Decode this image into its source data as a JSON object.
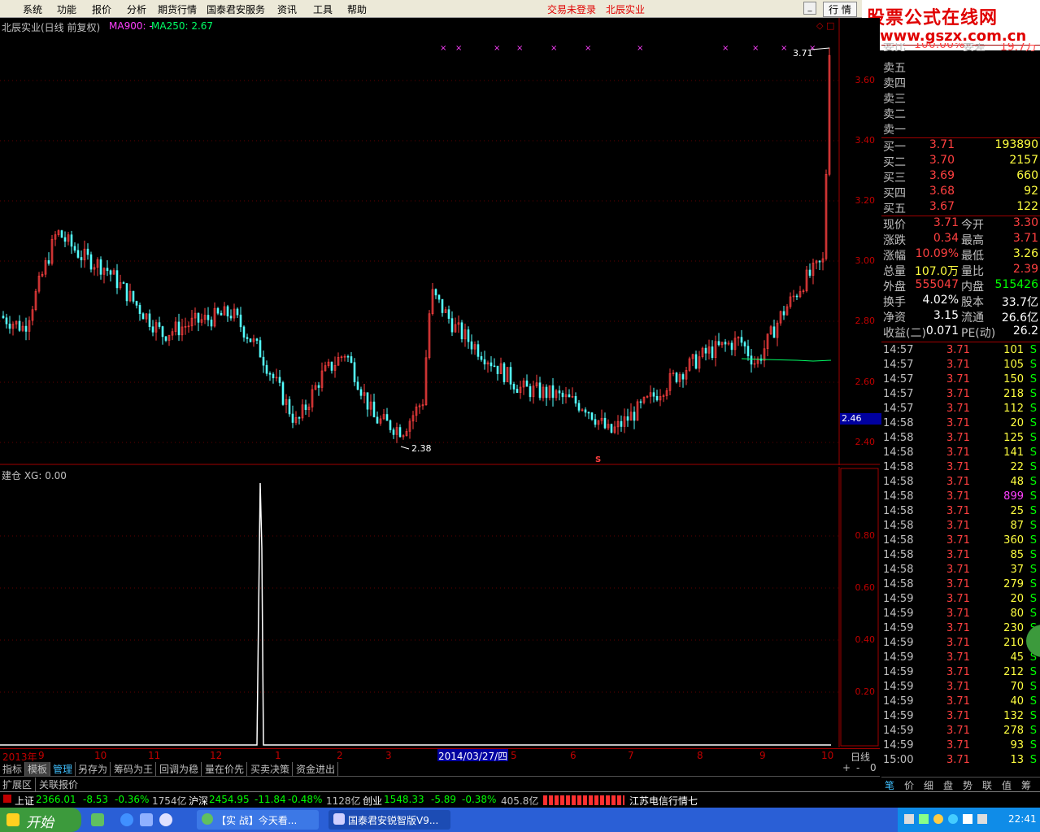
{
  "menu": {
    "items": [
      "系统",
      "功能",
      "报价",
      "分析",
      "期货行情",
      "国泰君安服务",
      "资讯",
      "工具",
      "帮助"
    ],
    "status_login": "交易未登录",
    "stock_name": "北辰实业",
    "quote_btn": "行 情"
  },
  "watermark": {
    "line1": "股票公式在线网",
    "line2": "www.gszx.com.cn"
  },
  "main_chart": {
    "title": "北辰实业(日线 前复权)",
    "ma900": "MA900: -",
    "ma250": "MA250: 2.67",
    "price_axis": [
      "3.60",
      "3.40",
      "3.20",
      "3.00",
      "2.80",
      "2.60",
      "2.40"
    ],
    "current_price_tag": "2.46",
    "high_label": "3.71",
    "low_label": "2.38",
    "s_marker": "S"
  },
  "sub_chart": {
    "title": "建仓 XG: 0.00",
    "axis": [
      "0.80",
      "0.60",
      "0.40",
      "0.20"
    ]
  },
  "time_axis": {
    "labels": [
      "2013年",
      "9",
      "10",
      "11",
      "12",
      "1",
      "2",
      "3",
      "2014/03/27/四",
      "5",
      "6",
      "7",
      "8",
      "9",
      "10"
    ],
    "period": "日线",
    "controls": [
      "+",
      "-",
      "0"
    ]
  },
  "tabs1": [
    "指标",
    "模板",
    "管理",
    "另存为",
    "筹码为王",
    "回调为稳",
    "量在价先",
    "买卖决策",
    "资金进出"
  ],
  "tabs2": [
    "扩展区",
    "关联报价"
  ],
  "order_book": {
    "top_row": {
      "label": "委比",
      "value": "100.00%",
      "label2": "委差",
      "value2": "19.7万"
    },
    "sells": [
      {
        "label": "卖五"
      },
      {
        "label": "卖四"
      },
      {
        "label": "卖三"
      },
      {
        "label": "卖二"
      },
      {
        "label": "卖一"
      }
    ],
    "buys": [
      {
        "label": "买一",
        "price": "3.71",
        "vol": "193890"
      },
      {
        "label": "买二",
        "price": "3.70",
        "vol": "2157"
      },
      {
        "label": "买三",
        "price": "3.69",
        "vol": "660"
      },
      {
        "label": "买四",
        "price": "3.68",
        "vol": "92"
      },
      {
        "label": "买五",
        "price": "3.67",
        "vol": "122"
      }
    ]
  },
  "quote_stats": [
    {
      "l1": "现价",
      "v1": "3.71",
      "c1": "red",
      "l2": "今开",
      "v2": "3.30",
      "c2": "red"
    },
    {
      "l1": "涨跌",
      "v1": "0.34",
      "c1": "red",
      "l2": "最高",
      "v2": "3.71",
      "c2": "red"
    },
    {
      "l1": "涨幅",
      "v1": "10.09%",
      "c1": "red",
      "l2": "最低",
      "v2": "3.26",
      "c2": "yellow"
    },
    {
      "l1": "总量",
      "v1": "107.0万",
      "c1": "yellow",
      "l2": "量比",
      "v2": "2.39",
      "c2": "red"
    },
    {
      "l1": "外盘",
      "v1": "555047",
      "c1": "red",
      "l2": "内盘",
      "v2": "515426",
      "c2": "green"
    },
    {
      "l1": "换手",
      "v1": "4.02%",
      "c1": "white",
      "l2": "股本",
      "v2": "33.7亿",
      "c2": "white"
    },
    {
      "l1": "净资",
      "v1": "3.15",
      "c1": "white",
      "l2": "流通",
      "v2": "26.6亿",
      "c2": "white"
    },
    {
      "l1": "收益(二)",
      "v1": "0.071",
      "c1": "white",
      "l2": "PE(动)",
      "v2": "26.2",
      "c2": "white"
    }
  ],
  "ticks": [
    {
      "t": "14:57",
      "p": "3.71",
      "v": "101",
      "s": "S"
    },
    {
      "t": "14:57",
      "p": "3.71",
      "v": "105",
      "s": "S"
    },
    {
      "t": "14:57",
      "p": "3.71",
      "v": "150",
      "s": "S"
    },
    {
      "t": "14:57",
      "p": "3.71",
      "v": "218",
      "s": "S"
    },
    {
      "t": "14:57",
      "p": "3.71",
      "v": "112",
      "s": "S"
    },
    {
      "t": "14:58",
      "p": "3.71",
      "v": "20",
      "s": "S"
    },
    {
      "t": "14:58",
      "p": "3.71",
      "v": "125",
      "s": "S"
    },
    {
      "t": "14:58",
      "p": "3.71",
      "v": "141",
      "s": "S"
    },
    {
      "t": "14:58",
      "p": "3.71",
      "v": "22",
      "s": "S"
    },
    {
      "t": "14:58",
      "p": "3.71",
      "v": "48",
      "s": "S"
    },
    {
      "t": "14:58",
      "p": "3.71",
      "v": "899",
      "s": "S"
    },
    {
      "t": "14:58",
      "p": "3.71",
      "v": "25",
      "s": "S"
    },
    {
      "t": "14:58",
      "p": "3.71",
      "v": "87",
      "s": "S"
    },
    {
      "t": "14:58",
      "p": "3.71",
      "v": "360",
      "s": "S"
    },
    {
      "t": "14:58",
      "p": "3.71",
      "v": "85",
      "s": "S"
    },
    {
      "t": "14:58",
      "p": "3.71",
      "v": "37",
      "s": "S"
    },
    {
      "t": "14:58",
      "p": "3.71",
      "v": "279",
      "s": "S"
    },
    {
      "t": "14:59",
      "p": "3.71",
      "v": "20",
      "s": "S"
    },
    {
      "t": "14:59",
      "p": "3.71",
      "v": "80",
      "s": "S"
    },
    {
      "t": "14:59",
      "p": "3.71",
      "v": "230",
      "s": "S"
    },
    {
      "t": "14:59",
      "p": "3.71",
      "v": "210",
      "s": "S"
    },
    {
      "t": "14:59",
      "p": "3.71",
      "v": "45",
      "s": "S"
    },
    {
      "t": "14:59",
      "p": "3.71",
      "v": "212",
      "s": "S"
    },
    {
      "t": "14:59",
      "p": "3.71",
      "v": "70",
      "s": "S"
    },
    {
      "t": "14:59",
      "p": "3.71",
      "v": "40",
      "s": "S"
    },
    {
      "t": "14:59",
      "p": "3.71",
      "v": "132",
      "s": "S"
    },
    {
      "t": "14:59",
      "p": "3.71",
      "v": "278",
      "s": "S"
    },
    {
      "t": "14:59",
      "p": "3.71",
      "v": "93",
      "s": "S"
    },
    {
      "t": "15:00",
      "p": "3.71",
      "v": "13",
      "s": "S"
    }
  ],
  "right_tabs": [
    "笔",
    "价",
    "细",
    "盘",
    "势",
    "联",
    "值",
    "筹"
  ],
  "status": {
    "sh_label": "上证",
    "sh_value": "2366.01",
    "sh_chg": "-8.53",
    "sh_pct": "-0.36%",
    "sh_amt": "1754亿",
    "hs_label": "沪深",
    "hs_value": "2454.95",
    "hs_chg": "-11.84",
    "hs_pct": "-0.48%",
    "hs_amt": "1128亿",
    "cy_label": "创业",
    "cy_value": "1548.33",
    "cy_chg": "-5.89",
    "cy_pct": "-0.38%",
    "cy_amt": "405.8亿",
    "server": "江苏电信行情七"
  },
  "taskbar": {
    "start": "开始",
    "item1": "【实   战】今天看...",
    "item2": "国泰君安锐智版V9...",
    "clock": "22:41"
  },
  "colors": {
    "up": "#ff4040",
    "down": "#00ffff",
    "grid": "#800000",
    "ma250": "#00ff66"
  }
}
